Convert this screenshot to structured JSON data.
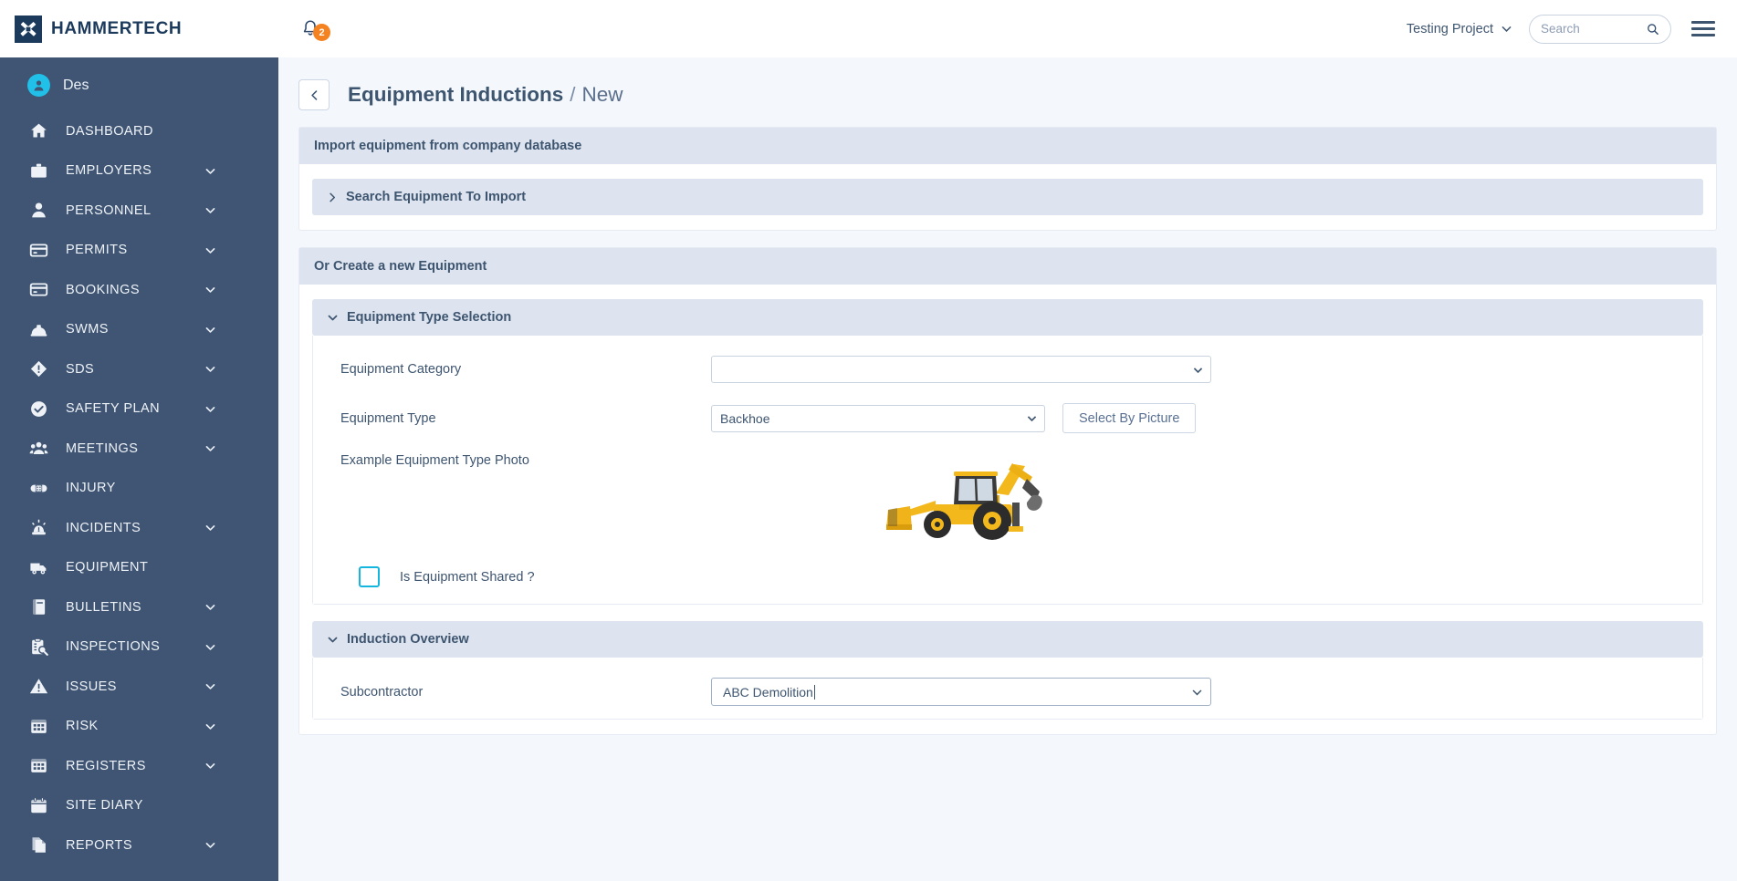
{
  "brand": {
    "name": "HAMMERTECH",
    "logo_icon": "hammer-logo-icon",
    "logo_bg": "#1b3a5c"
  },
  "topbar": {
    "notifications": {
      "icon": "bell-icon",
      "count": "2",
      "badge_color": "#f58220"
    },
    "project": {
      "label": "Testing Project",
      "chevron_icon": "chevron-down-icon"
    },
    "search": {
      "placeholder": "Search",
      "value": "",
      "icon": "search-icon"
    },
    "menu_icon": "hamburger-menu-icon"
  },
  "sidebar": {
    "user": {
      "name": "Des",
      "avatar_icon": "user-avatar-icon",
      "avatar_color": "#21c0e8"
    },
    "bg_color": "#3f5573",
    "items": [
      {
        "label": "DASHBOARD",
        "icon": "home-icon",
        "expandable": false
      },
      {
        "label": "EMPLOYERS",
        "icon": "briefcase-icon",
        "expandable": true
      },
      {
        "label": "PERSONNEL",
        "icon": "person-icon",
        "expandable": true
      },
      {
        "label": "PERMITS",
        "icon": "card-icon",
        "expandable": true
      },
      {
        "label": "BOOKINGS",
        "icon": "card-icon",
        "expandable": true
      },
      {
        "label": "SWMS",
        "icon": "hardhat-icon",
        "expandable": true
      },
      {
        "label": "SDS",
        "icon": "hazard-diamond-icon",
        "expandable": true
      },
      {
        "label": "SAFETY PLAN",
        "icon": "check-circle-icon",
        "expandable": true
      },
      {
        "label": "MEETINGS",
        "icon": "users-group-icon",
        "expandable": true
      },
      {
        "label": "INJURY",
        "icon": "bandage-icon",
        "expandable": false
      },
      {
        "label": "INCIDENTS",
        "icon": "siren-icon",
        "expandable": true
      },
      {
        "label": "EQUIPMENT",
        "icon": "truck-icon",
        "expandable": false
      },
      {
        "label": "BULLETINS",
        "icon": "book-icon",
        "expandable": true
      },
      {
        "label": "INSPECTIONS",
        "icon": "clipboard-search-icon",
        "expandable": true
      },
      {
        "label": "ISSUES",
        "icon": "warning-triangle-icon",
        "expandable": true
      },
      {
        "label": "RISK",
        "icon": "grid-icon",
        "expandable": true
      },
      {
        "label": "REGISTERS",
        "icon": "grid-icon",
        "expandable": true
      },
      {
        "label": "SITE DIARY",
        "icon": "calendar-icon",
        "expandable": false
      },
      {
        "label": "REPORTS",
        "icon": "documents-icon",
        "expandable": true
      }
    ]
  },
  "page": {
    "back_icon": "chevron-left-icon",
    "breadcrumb_main": "Equipment Inductions",
    "breadcrumb_sep": "/",
    "breadcrumb_sub": "New"
  },
  "import_section": {
    "header": "Import equipment from company database",
    "collapsible": {
      "label": "Search Equipment To Import",
      "icon": "chevron-right-icon",
      "expanded": false
    }
  },
  "create_section": {
    "header": "Or Create a new Equipment",
    "equipment_type_selection": {
      "label": "Equipment Type Selection",
      "icon": "chevron-down-icon",
      "fields": {
        "category_label": "Equipment Category",
        "category_value": "",
        "type_label": "Equipment Type",
        "type_value": "Backhoe",
        "select_by_picture_button": "Select By Picture",
        "photo_label": "Example Equipment Type Photo",
        "photo_alt": "backhoe-loader-photo",
        "shared_label": "Is Equipment Shared ?",
        "shared_checked": false
      }
    },
    "induction_overview": {
      "label": "Induction Overview",
      "icon": "chevron-down-icon",
      "subcontractor_label": "Subcontractor",
      "subcontractor_value": "ABC Demolition"
    }
  }
}
